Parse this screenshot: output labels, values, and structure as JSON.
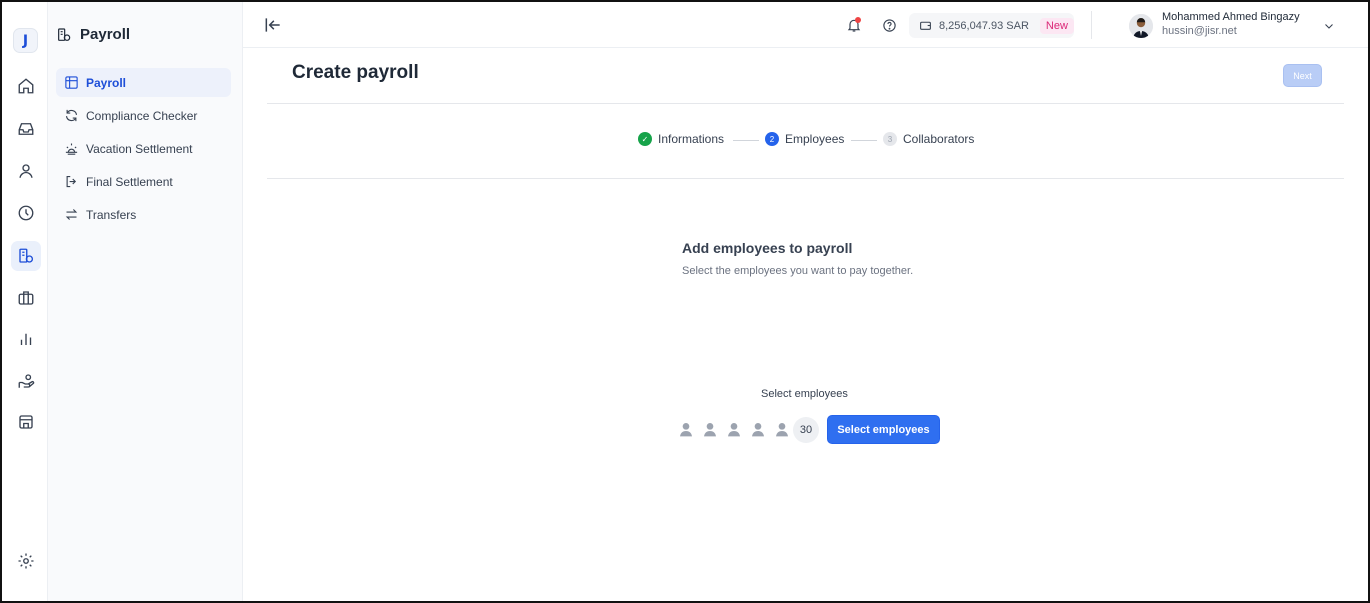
{
  "rail": {
    "logo_letter": "J",
    "icons": [
      "home-icon",
      "inbox-icon",
      "person-icon",
      "clock-icon",
      "payroll-icon",
      "briefcase-icon",
      "bar-chart-icon",
      "hand-coins-icon",
      "store-icon",
      "settings-icon"
    ]
  },
  "sidebar": {
    "title": "Payroll",
    "items": [
      {
        "label": "Payroll",
        "icon": "table-icon"
      },
      {
        "label": "Compliance Checker",
        "icon": "refresh-icon"
      },
      {
        "label": "Vacation Settlement",
        "icon": "sunset-icon"
      },
      {
        "label": "Final Settlement",
        "icon": "exit-icon"
      },
      {
        "label": "Transfers",
        "icon": "transfer-icon"
      }
    ]
  },
  "header": {
    "balance": "8,256,047.93 SAR",
    "new_badge": "New",
    "user_name": "Mohammed Ahmed Bingazy",
    "user_email": "hussin@jisr.net"
  },
  "page": {
    "title": "Create payroll",
    "next_label": "Next"
  },
  "steps": [
    {
      "label": "Informations",
      "marker": "✓",
      "state": "done"
    },
    {
      "label": "Employees",
      "marker": "2",
      "state": "current"
    },
    {
      "label": "Collaborators",
      "marker": "3",
      "state": "todo"
    }
  ],
  "content": {
    "title": "Add employees to payroll",
    "subtitle": "Select the employees you want to pay together.",
    "select_label": "Select employees",
    "employee_count": "30",
    "select_button": "Select employees"
  },
  "colors": {
    "accent": "#2f6ff0",
    "done": "#16a34a",
    "badge_pink": "#db2777"
  }
}
